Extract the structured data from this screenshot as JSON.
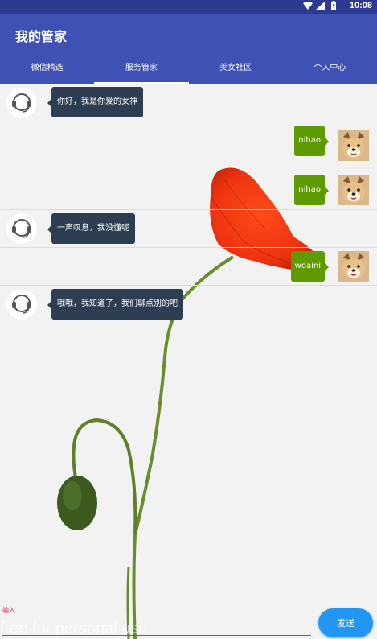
{
  "status_bar": {
    "time": "10:08"
  },
  "app": {
    "title": "我的管家"
  },
  "tabs": [
    {
      "label": "微信精选",
      "active": false
    },
    {
      "label": "服务管家",
      "active": true
    },
    {
      "label": "美女社区",
      "active": false
    },
    {
      "label": "个人中心",
      "active": false
    }
  ],
  "messages": [
    {
      "side": "left",
      "text": "你好，我是你爱的女神"
    },
    {
      "side": "right",
      "text": "nihao"
    },
    {
      "side": "right",
      "text": "nihao"
    },
    {
      "side": "left",
      "text": "一声叹息，我没懂呢"
    },
    {
      "side": "right",
      "text": "woaini"
    },
    {
      "side": "left",
      "text": "哦哦，我知道了，我们聊点别的吧"
    }
  ],
  "input": {
    "label": "输入",
    "watermark": "free for personal use"
  },
  "send_label": "发送",
  "colors": {
    "appbar": "#3f51b5",
    "statusbar": "#2c3a91",
    "bot_bubble": "#2e3e52",
    "user_bubble": "#5e9b00",
    "accent": "#e91e63",
    "send": "#2196f3"
  }
}
